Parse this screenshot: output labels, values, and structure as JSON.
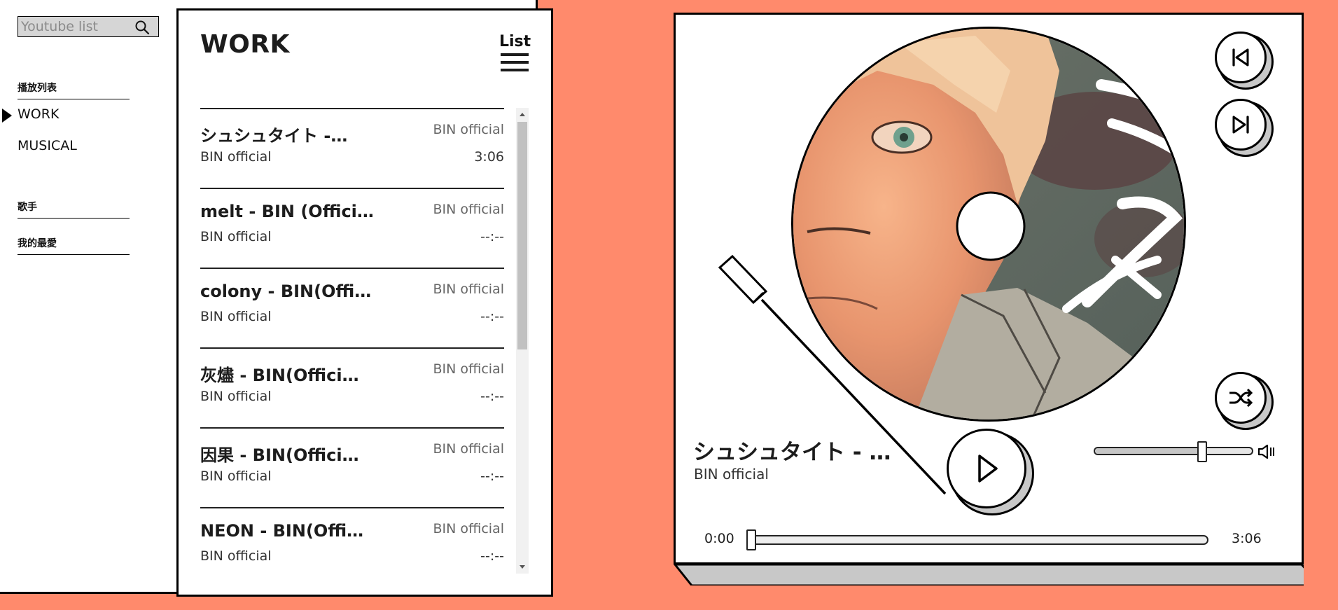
{
  "sidebar": {
    "search": {
      "placeholder": "Youtube list",
      "icon": "search-icon"
    },
    "sections": [
      {
        "label": "播放列表"
      },
      {
        "label": "歌手"
      },
      {
        "label": "我的最愛"
      }
    ],
    "playlists": [
      {
        "label": "WORK",
        "active": true
      },
      {
        "label": "MUSICAL",
        "active": false
      }
    ]
  },
  "playlist": {
    "title": "WORK",
    "list_button_label": "List",
    "tracks": [
      {
        "title": "シュシュタイト -…",
        "subtitle": "BIN official",
        "channel": "BIN official",
        "duration": "3:06"
      },
      {
        "title": "melt - BIN (Offici…",
        "subtitle": "BIN official",
        "channel": "BIN official",
        "duration": "--:--"
      },
      {
        "title": "colony - BIN(Offi…",
        "subtitle": "BIN official",
        "channel": "BIN official",
        "duration": "--:--"
      },
      {
        "title": "灰燼 - BIN(Offici…",
        "subtitle": "BIN official",
        "channel": "BIN official",
        "duration": "--:--"
      },
      {
        "title": "因果 - BIN(Offici…",
        "subtitle": "BIN official",
        "channel": "BIN official",
        "duration": "--:--"
      },
      {
        "title": "NEON - BIN(Offi…",
        "subtitle": "BIN official",
        "channel": "BIN official",
        "duration": "--:--"
      }
    ]
  },
  "player": {
    "now_playing_title": "シュシュタイト - …",
    "now_playing_artist": "BIN official",
    "current_time": "0:00",
    "total_time": "3:06",
    "progress_fraction": 0.0,
    "volume_fraction": 0.68,
    "icons": {
      "prev": "skip-previous-icon",
      "next": "skip-next-icon",
      "shuffle": "shuffle-icon",
      "play": "play-icon",
      "volume": "volume-icon"
    }
  },
  "colors": {
    "background": "#ff8a6c",
    "panel": "#ffffff",
    "outline": "#000000",
    "shadow": "#c8c8c8"
  }
}
